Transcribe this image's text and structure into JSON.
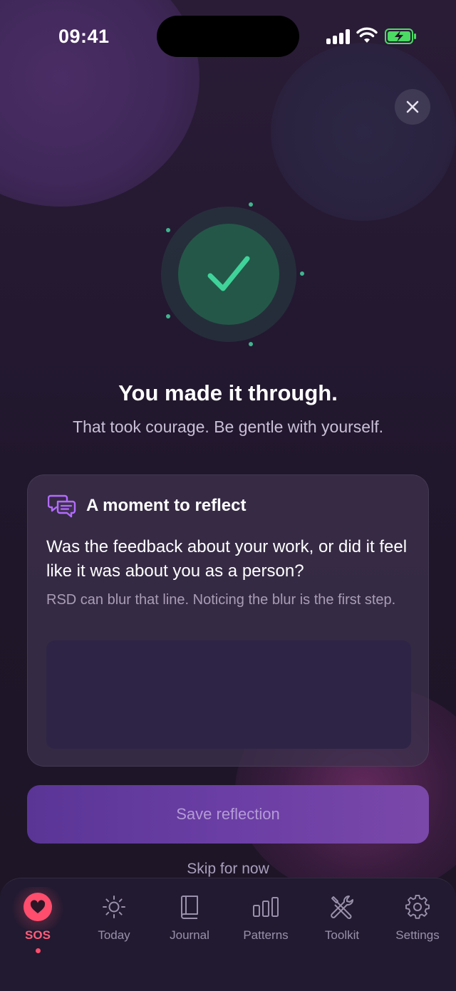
{
  "status_bar": {
    "time": "09:41"
  },
  "headline": "You made it through.",
  "subline": "That took courage. Be gentle with yourself.",
  "reflect_card": {
    "title": "A moment to reflect",
    "question": "Was the feedback about your work, or did it feel like it was about you as a person?",
    "hint": "RSD can blur that line. Noticing the blur is the first step.",
    "input_value": "",
    "input_placeholder": ""
  },
  "actions": {
    "save_label": "Save reflection",
    "skip_label": "Skip for now"
  },
  "tabbar": {
    "items": [
      {
        "label": "SOS",
        "icon": "heart-icon",
        "active": true
      },
      {
        "label": "Today",
        "icon": "sun-icon",
        "active": false
      },
      {
        "label": "Journal",
        "icon": "book-icon",
        "active": false
      },
      {
        "label": "Patterns",
        "icon": "bar-chart-icon",
        "active": false
      },
      {
        "label": "Toolkit",
        "icon": "tools-icon",
        "active": false
      },
      {
        "label": "Settings",
        "icon": "gear-icon",
        "active": false
      }
    ]
  },
  "colors": {
    "accent_success": "#3fd39a",
    "accent_sos": "#ff4d6d",
    "button_purple": "#6c3fa6",
    "battery_green": "#4cd964"
  }
}
